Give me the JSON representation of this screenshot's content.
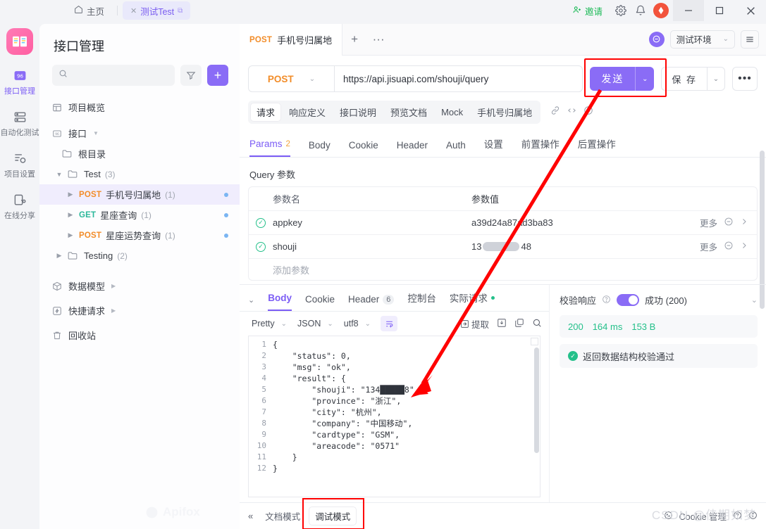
{
  "titlebar": {
    "home_tab": "主页",
    "project_tab": "测试Test",
    "invite": "邀请",
    "icons": {
      "home": "home-icon",
      "gear": "gear-icon",
      "bell": "bell-icon",
      "avatar": "user-avatar"
    },
    "window": {
      "minimize": "—",
      "maximize": "□",
      "close": "✕"
    }
  },
  "rail": {
    "logo": "apifox-logo",
    "items": [
      {
        "label": "接口管理",
        "icon": "api-management-icon",
        "active": true
      },
      {
        "label": "自动化测试",
        "icon": "automation-test-icon",
        "active": false
      },
      {
        "label": "项目设置",
        "icon": "project-settings-icon",
        "active": false
      },
      {
        "label": "在线分享",
        "icon": "online-share-icon",
        "active": false
      }
    ]
  },
  "sidebar": {
    "title": "接口管理",
    "search_placeholder": "",
    "search_value": "",
    "filter_icon": "filter-icon",
    "add_icon": "plus-icon",
    "watermark": "Apifox",
    "tree": [
      {
        "label": "项目概览",
        "icon": "overview-icon",
        "indent": 0,
        "type": "nav"
      },
      {
        "label": "接口",
        "icon": "api-icon",
        "indent": 0,
        "type": "nav",
        "caret": true
      },
      {
        "label": "根目录",
        "icon": "folder-icon",
        "indent": 1,
        "type": "folder"
      },
      {
        "label": "Test",
        "count": "(3)",
        "icon": "folder-icon",
        "indent": 1,
        "type": "folder",
        "expanded": true
      },
      {
        "label": "手机号归属地",
        "method": "POST",
        "count": "(1)",
        "indent": 2,
        "type": "api",
        "selected": true,
        "dot": true
      },
      {
        "label": "星座查询",
        "method": "GET",
        "count": "(1)",
        "indent": 2,
        "type": "api",
        "dot": true
      },
      {
        "label": "星座运势查询",
        "method": "POST",
        "count": "(1)",
        "indent": 2,
        "type": "api",
        "dot": true
      },
      {
        "label": "Testing",
        "count": "(2)",
        "icon": "folder-icon",
        "indent": 1,
        "type": "folder"
      }
    ],
    "bottom_items": [
      {
        "label": "数据模型",
        "icon": "cube-icon",
        "arrow": true
      },
      {
        "label": "快捷请求",
        "icon": "bolt-icon",
        "arrow": true
      },
      {
        "label": "回收站",
        "icon": "trash-icon",
        "arrow": false
      }
    ]
  },
  "main": {
    "tab": {
      "method": "POST",
      "name": "手机号归属地"
    },
    "tab_plus": "+",
    "tab_more": "···",
    "sync_icon": "sync-icon",
    "environment": "测试环境",
    "menu_icon": "hamburger-icon",
    "request": {
      "method": "POST",
      "url": "https://api.jisuapi.com/shouji/query",
      "send_label": "发送",
      "save_label": "保 存",
      "more_label": "•••"
    },
    "doc_tabs": [
      {
        "label": "请求",
        "active": true
      },
      {
        "label": "响应定义",
        "active": false
      },
      {
        "label": "接口说明",
        "active": false
      },
      {
        "label": "预览文档",
        "active": false
      },
      {
        "label": "Mock",
        "active": false
      },
      {
        "label": "手机号归属地",
        "active": false
      }
    ],
    "doc_tab_icons": [
      "link-icon",
      "code-icon",
      "history-icon"
    ],
    "param_tabs": [
      {
        "label": "Params",
        "badge": "2",
        "active": true
      },
      {
        "label": "Body",
        "active": false
      },
      {
        "label": "Cookie",
        "active": false
      },
      {
        "label": "Header",
        "active": false
      },
      {
        "label": "Auth",
        "active": false
      },
      {
        "label": "设置",
        "active": false
      },
      {
        "label": "前置操作",
        "active": false
      },
      {
        "label": "后置操作",
        "active": false
      }
    ],
    "query_label": "Query 参数",
    "table": {
      "headers": [
        "参数名",
        "参数值"
      ],
      "rows": [
        {
          "name": "appkey",
          "value": "a39d24a87ad3ba83",
          "checked": true,
          "more": "更多",
          "redacted": false
        },
        {
          "name": "shouji",
          "value_prefix": "13",
          "value_suffix": "48",
          "checked": true,
          "more": "更多",
          "redacted": true
        }
      ],
      "add_row": "添加参数"
    }
  },
  "response": {
    "tabs": [
      {
        "label": "Body",
        "active": true
      },
      {
        "label": "Cookie",
        "active": false
      },
      {
        "label": "Header",
        "badge": "6",
        "active": false
      },
      {
        "label": "控制台",
        "active": false
      },
      {
        "label": "实际请求",
        "dot": true,
        "active": false
      }
    ],
    "toolbar": {
      "pretty": "Pretty",
      "format": "JSON",
      "encoding": "utf8",
      "wrap_icon": "wrap-lines-icon",
      "extract": "提取",
      "download_icon": "download-icon",
      "copy_icon": "copy-icon",
      "search_icon": "search-icon"
    },
    "body_lines": [
      {
        "n": "1",
        "text": "{"
      },
      {
        "n": "2",
        "text": "    \"status\": 0,"
      },
      {
        "n": "3",
        "text": "    \"msg\": \"ok\","
      },
      {
        "n": "4",
        "text": "    \"result\": {"
      },
      {
        "n": "5",
        "text": "        \"shouji\": \"134█████8\","
      },
      {
        "n": "6",
        "text": "        \"province\": \"浙江\","
      },
      {
        "n": "7",
        "text": "        \"city\": \"杭州\","
      },
      {
        "n": "8",
        "text": "        \"company\": \"中国移动\","
      },
      {
        "n": "9",
        "text": "        \"cardtype\": \"GSM\","
      },
      {
        "n": "10",
        "text": "        \"areacode\": \"0571\""
      },
      {
        "n": "11",
        "text": "    }"
      },
      {
        "n": "12",
        "text": "}"
      }
    ],
    "validation": {
      "label": "校验响应",
      "help_icon": "question-icon",
      "toggle_on": true,
      "status": "成功 (200)",
      "stat_code": "200",
      "stat_time": "164 ms",
      "stat_size": "153 B",
      "pass_message": "返回数据结构校验通过"
    }
  },
  "bottom": {
    "collapse_icon": "collapse-left-icon",
    "modes": [
      {
        "label": "文档模式",
        "active": false
      },
      {
        "label": "调试模式",
        "active": true,
        "highlighted": true
      }
    ],
    "cookie_manage": "Cookie 管理",
    "watermark": "CSDN @佳期如梦"
  },
  "colors": {
    "accent": "#8a6cf6",
    "method_post": "#f28c28",
    "method_get": "#2bb89a",
    "success": "#24c08a",
    "highlight_red": "#ff0000",
    "invite_green": "#19b955"
  }
}
